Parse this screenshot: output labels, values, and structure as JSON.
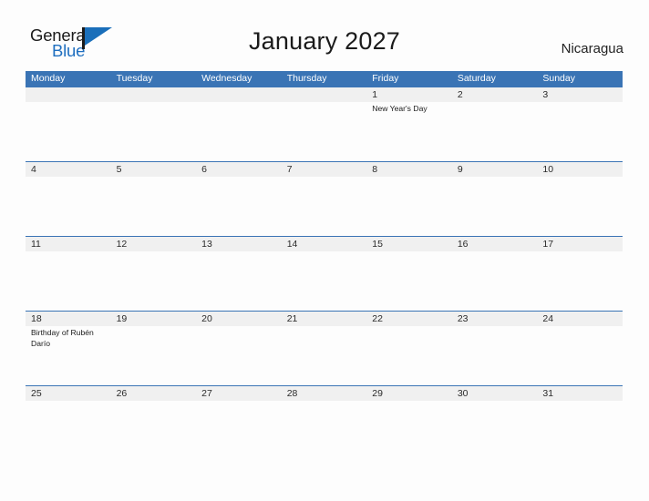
{
  "brand": {
    "name_part1": "General",
    "name_part2": "Blue",
    "flag_icon": "flag-triangle-icon",
    "accent_color": "#1a6fba"
  },
  "header": {
    "title": "January 2027",
    "country": "Nicaragua"
  },
  "theme": {
    "header_blue": "#3a74b5",
    "row_band_gray": "#f0f0f0",
    "page_background": "#fdfdfd",
    "text_color": "#1b1b1b"
  },
  "calendar": {
    "month": "January",
    "year": "2027",
    "weekday_headers": [
      "Monday",
      "Tuesday",
      "Wednesday",
      "Thursday",
      "Friday",
      "Saturday",
      "Sunday"
    ],
    "weeks": [
      {
        "days": [
          {
            "num": "",
            "event": ""
          },
          {
            "num": "",
            "event": ""
          },
          {
            "num": "",
            "event": ""
          },
          {
            "num": "",
            "event": ""
          },
          {
            "num": "1",
            "event": "New Year's Day"
          },
          {
            "num": "2",
            "event": ""
          },
          {
            "num": "3",
            "event": ""
          }
        ]
      },
      {
        "days": [
          {
            "num": "4",
            "event": ""
          },
          {
            "num": "5",
            "event": ""
          },
          {
            "num": "6",
            "event": ""
          },
          {
            "num": "7",
            "event": ""
          },
          {
            "num": "8",
            "event": ""
          },
          {
            "num": "9",
            "event": ""
          },
          {
            "num": "10",
            "event": ""
          }
        ]
      },
      {
        "days": [
          {
            "num": "11",
            "event": ""
          },
          {
            "num": "12",
            "event": ""
          },
          {
            "num": "13",
            "event": ""
          },
          {
            "num": "14",
            "event": ""
          },
          {
            "num": "15",
            "event": ""
          },
          {
            "num": "16",
            "event": ""
          },
          {
            "num": "17",
            "event": ""
          }
        ]
      },
      {
        "days": [
          {
            "num": "18",
            "event": "Birthday of Rubén Darío"
          },
          {
            "num": "19",
            "event": ""
          },
          {
            "num": "20",
            "event": ""
          },
          {
            "num": "21",
            "event": ""
          },
          {
            "num": "22",
            "event": ""
          },
          {
            "num": "23",
            "event": ""
          },
          {
            "num": "24",
            "event": ""
          }
        ]
      },
      {
        "days": [
          {
            "num": "25",
            "event": ""
          },
          {
            "num": "26",
            "event": ""
          },
          {
            "num": "27",
            "event": ""
          },
          {
            "num": "28",
            "event": ""
          },
          {
            "num": "29",
            "event": ""
          },
          {
            "num": "30",
            "event": ""
          },
          {
            "num": "31",
            "event": ""
          }
        ]
      }
    ]
  }
}
